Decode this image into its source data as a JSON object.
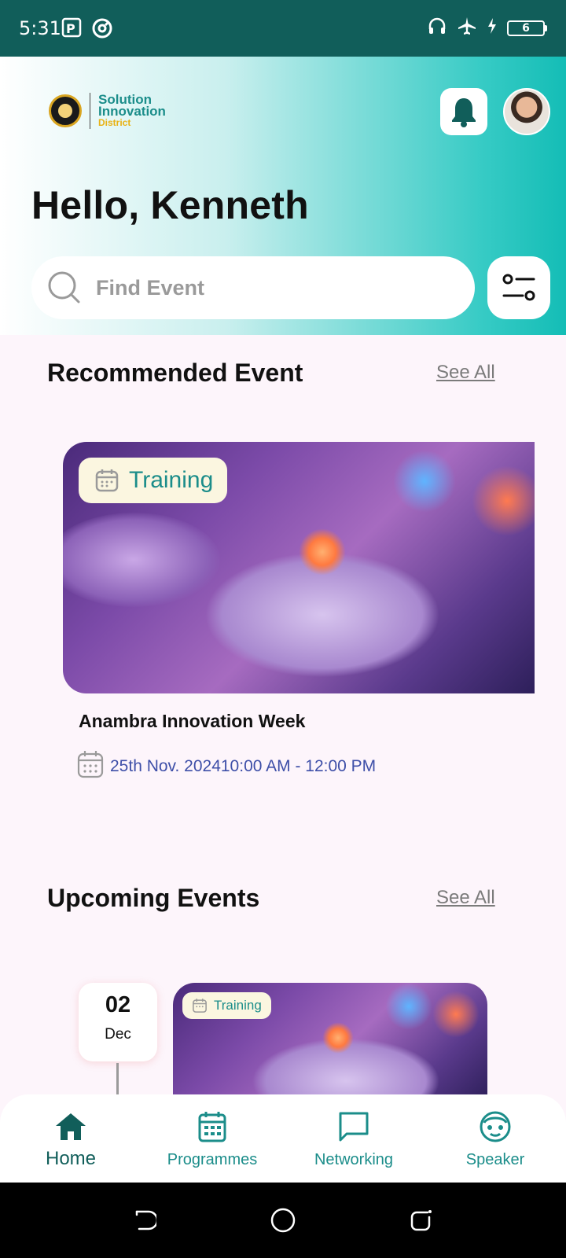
{
  "status_bar": {
    "time": "5:31",
    "battery_level": "6",
    "icons": [
      "p-app-icon",
      "at-sign-icon",
      "headphones-icon",
      "airplane-icon",
      "charging-icon",
      "battery-icon"
    ]
  },
  "header": {
    "logo": {
      "line1": "Solution",
      "line2": "Innovation",
      "line3": "District"
    },
    "greeting": "Hello, Kenneth",
    "search_placeholder": "Find Event"
  },
  "recommended": {
    "title": "Recommended Event",
    "see_all": "See All",
    "event": {
      "badge": "Training",
      "name": "Anambra Innovation Week",
      "date_time": "25th Nov. 202410:00 AM - 12:00 PM"
    }
  },
  "upcoming": {
    "title": "Upcoming Events",
    "see_all": "See All",
    "events": [
      {
        "day": "02",
        "month": "Dec",
        "badge": "Training"
      }
    ]
  },
  "bottom_nav": {
    "items": [
      {
        "label": "Home",
        "icon": "home-icon",
        "active": true
      },
      {
        "label": "Programmes",
        "icon": "calendar-icon",
        "active": false
      },
      {
        "label": "Networking",
        "icon": "chat-icon",
        "active": false
      },
      {
        "label": "Speaker",
        "icon": "speaker-icon",
        "active": false
      }
    ]
  },
  "colors": {
    "primary": "#1b8d8a",
    "dark_teal": "#115e5a",
    "background": "#fdf5fb",
    "accent_gold": "#e8b215",
    "date_text": "#3e4fa8"
  }
}
